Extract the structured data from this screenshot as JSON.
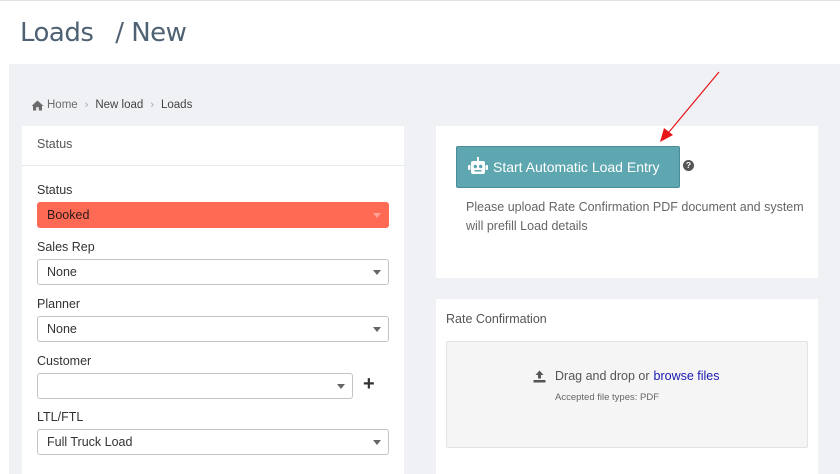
{
  "header": {
    "title": "Loads",
    "separator": "/",
    "subtitle": "New"
  },
  "breadcrumb": {
    "items": [
      {
        "label": "Home",
        "icon": "home-icon"
      },
      {
        "label": "New load"
      },
      {
        "label": "Loads"
      }
    ]
  },
  "status_panel": {
    "heading": "Status",
    "fields": {
      "status": {
        "label": "Status",
        "value": "Booked",
        "color": "#ff6a55"
      },
      "sales_rep": {
        "label": "Sales Rep",
        "value": "None"
      },
      "planner": {
        "label": "Planner",
        "value": "None"
      },
      "customer": {
        "label": "Customer",
        "value": ""
      },
      "ltl_ftl": {
        "label": "LTL/FTL",
        "value": "Full Truck Load"
      }
    }
  },
  "auto_entry": {
    "button_label": "Start Automatic Load Entry",
    "button_color": "#5ea6b0",
    "help": "?",
    "description": "Please upload Rate Confirmation PDF document and system will prefill Load details"
  },
  "rate_confirmation": {
    "heading": "Rate Confirmation",
    "drop_text": "Drag and drop or",
    "browse_label": "browse files",
    "accepted": "Accepted file types: PDF"
  },
  "annotation": {
    "color": "#e8151b"
  }
}
